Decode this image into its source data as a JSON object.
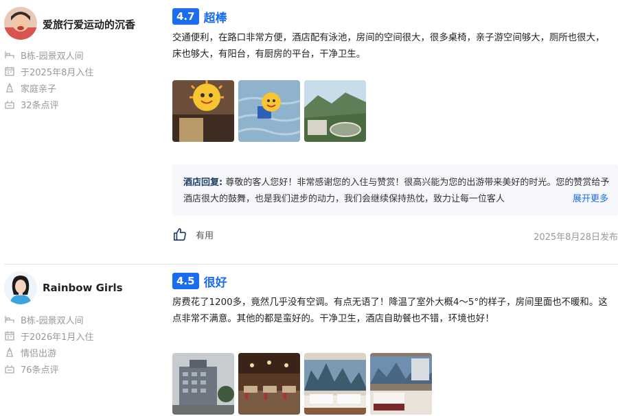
{
  "reviews": [
    {
      "user": {
        "name": "爱旅行爱运动的沉香"
      },
      "meta": {
        "room": "B栋-园景双人间",
        "checkin": "于2025年8月入住",
        "trip_type": "家庭亲子",
        "review_count": "32条点评"
      },
      "score": "4.7",
      "score_word": "超棒",
      "text": "交通便利，在路口非常方便，酒店配有泳池，房间的空间很大，很多桌椅，亲子游空间够大，厕所也很大，床也够大，有阳台，有厨房的平台，干净卫生。",
      "reply": {
        "label": "酒店回复:",
        "text": "尊敬的客人您好！非常感谢您的入住与赞赏！很高兴能为您的出游带来美好的时光。您的赞赏给予酒店很大的鼓舞，也是我们进步的动力，我们会继续保持热忱，致力让每一位客人",
        "expand": "展开更多"
      },
      "useful_label": "有用",
      "date": "2025年8月28日发布"
    },
    {
      "user": {
        "name": "Rainbow Girls"
      },
      "meta": {
        "room": "B栋-园景双人间",
        "checkin": "于2026年1月入住",
        "trip_type": "情侣出游",
        "review_count": "76条点评"
      },
      "score": "4.5",
      "score_word": "很好",
      "text": "房费花了1200多，竟然几乎没有空调。有点无语了！降温了室外大概4～5°的样子，房间里面也不暖和。这点非常不满意。其他的都是蛮好的。干净卫生，酒店自助餐也不错，环境也好！"
    }
  ],
  "colors": {
    "accent": "#1a6cf0",
    "meta_text": "#999999",
    "reply_bg": "#f5f7fa"
  },
  "icons": [
    "bed-icon",
    "calendar-icon",
    "trip-type-icon",
    "review-count-icon",
    "thumbs-up-icon"
  ]
}
